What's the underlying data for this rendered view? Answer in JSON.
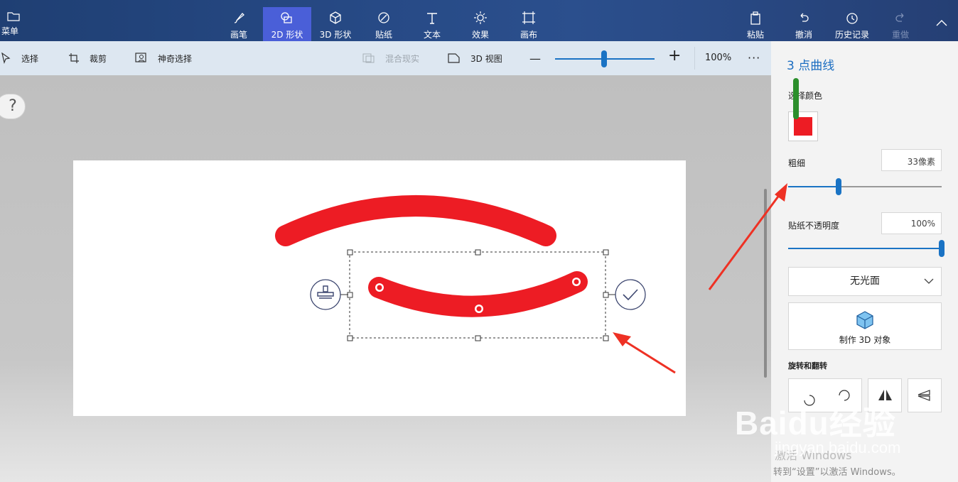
{
  "ribbon": {
    "menu_label": "菜单",
    "tabs": [
      {
        "label": "画笔",
        "icon": "brush-icon"
      },
      {
        "label": "2D 形状",
        "icon": "2d-shapes-icon"
      },
      {
        "label": "3D 形状",
        "icon": "3d-shapes-icon"
      },
      {
        "label": "贴纸",
        "icon": "sticker-icon"
      },
      {
        "label": "文本",
        "icon": "text-icon"
      },
      {
        "label": "效果",
        "icon": "effects-icon"
      },
      {
        "label": "画布",
        "icon": "canvas-icon"
      }
    ],
    "active_tab": "2D 形状",
    "right": {
      "paste": "粘贴",
      "undo": "撤消",
      "history": "历史记录",
      "redo": "重做"
    }
  },
  "toolbar": {
    "select": "选择",
    "crop": "裁剪",
    "magic_select": "神奇选择",
    "mixed_reality": "混合现实",
    "view_3d": "3D 视图",
    "zoom_minus": "—",
    "zoom_plus": "+",
    "zoom_level": "100%",
    "zoom_fraction": 0.47,
    "more": "···"
  },
  "help": "?",
  "panel": {
    "title": "3 点曲线",
    "choose_color": "选择颜色",
    "color": "#ed1c24",
    "thickness_label": "粗细",
    "thickness_value": "33像素",
    "thickness_fraction": 0.33,
    "opacity_label": "贴纸不透明度",
    "opacity_value": "100%",
    "opacity_fraction": 1.0,
    "finish": "无光面",
    "make_3d": "制作 3D 对象",
    "rotate_flip": "旋转和翻转"
  },
  "colors": {
    "stroke": "#ed1c24",
    "annotation_arrow": "#ee3124",
    "accent": "#1a73c4",
    "active_tab": "#4a5fd8"
  },
  "overlay": {
    "watermark": "Baidu经验",
    "watermark_sub": "jingyan.baidu.com",
    "activate_title": "激活 Windows",
    "activate_text": "转到“设置”以激活 Windows。"
  }
}
